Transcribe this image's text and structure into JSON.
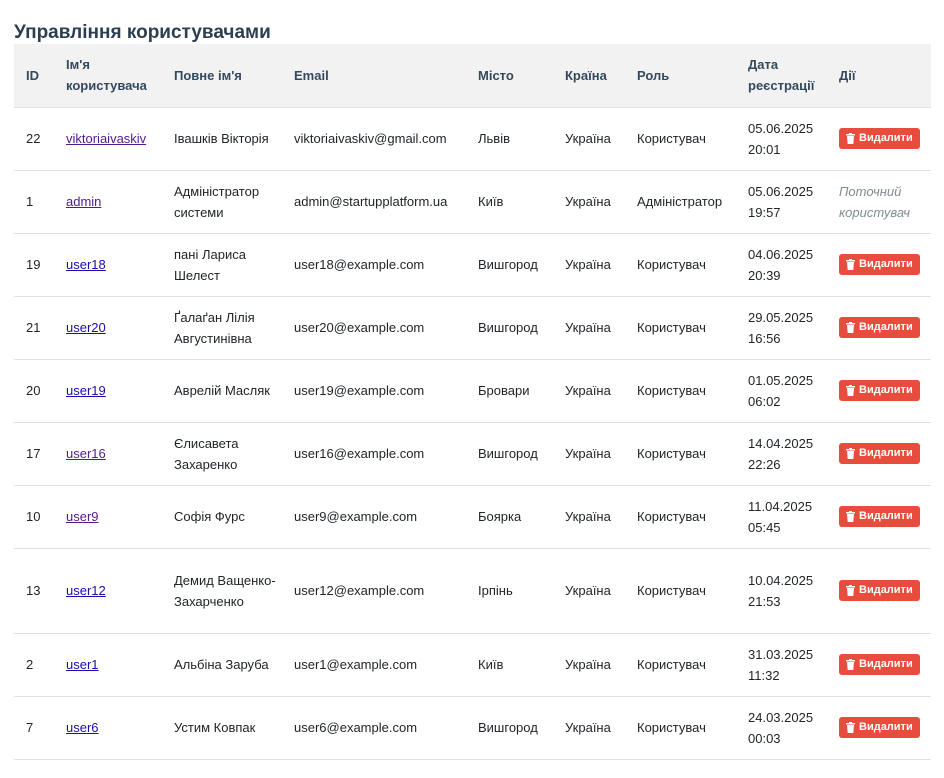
{
  "page": {
    "title": "Управління користувачами"
  },
  "table": {
    "headers": [
      "ID",
      "Ім'я користувача",
      "Повне ім'я",
      "Email",
      "Місто",
      "Країна",
      "Роль",
      "Дата реєстрації",
      "Дії"
    ],
    "delete_label": "Видалити",
    "current_user_label": "Поточний користувач",
    "rows": [
      {
        "id": "22",
        "username": "viktoriaivaskiv",
        "visited": true,
        "full_name": "Івашків Вікторія",
        "email": "viktoriaivaskiv@gmail.com",
        "city": "Львів",
        "country": "Україна",
        "role": "Користувач",
        "date": "05.06.2025",
        "time": "20:01",
        "current": false
      },
      {
        "id": "1",
        "username": "admin",
        "visited": true,
        "full_name": "Адміністратор системи",
        "email": "admin@startupplatform.ua",
        "city": "Київ",
        "country": "Україна",
        "role": "Адміністратор",
        "date": "05.06.2025",
        "time": "19:57",
        "current": true
      },
      {
        "id": "19",
        "username": "user18",
        "visited": false,
        "full_name": "пані Лариса Шелест",
        "email": "user18@example.com",
        "city": "Вишгород",
        "country": "Україна",
        "role": "Користувач",
        "date": "04.06.2025",
        "time": "20:39",
        "current": false
      },
      {
        "id": "21",
        "username": "user20",
        "visited": false,
        "full_name": "Ґалаґан Лілія Августинівна",
        "email": "user20@example.com",
        "city": "Вишгород",
        "country": "Україна",
        "role": "Користувач",
        "date": "29.05.2025",
        "time": "16:56",
        "current": false
      },
      {
        "id": "20",
        "username": "user19",
        "visited": false,
        "full_name": "Аврелій Масляк",
        "email": "user19@example.com",
        "city": "Бровари",
        "country": "Україна",
        "role": "Користувач",
        "date": "01.05.2025",
        "time": "06:02",
        "current": false
      },
      {
        "id": "17",
        "username": "user16",
        "visited": true,
        "full_name": "Єлисавета Захаренко",
        "email": "user16@example.com",
        "city": "Вишгород",
        "country": "Україна",
        "role": "Користувач",
        "date": "14.04.2025",
        "time": "22:26",
        "current": false
      },
      {
        "id": "10",
        "username": "user9",
        "visited": true,
        "full_name": "Софія Фурс",
        "email": "user9@example.com",
        "city": "Боярка",
        "country": "Україна",
        "role": "Користувач",
        "date": "11.04.2025",
        "time": "05:45",
        "current": false
      },
      {
        "id": "13",
        "username": "user12",
        "visited": false,
        "full_name": "Демид Ващенко-Захарченко",
        "email": "user12@example.com",
        "city": "Ірпінь",
        "country": "Україна",
        "role": "Користувач",
        "date": "10.04.2025",
        "time": "21:53",
        "current": false
      },
      {
        "id": "2",
        "username": "user1",
        "visited": false,
        "full_name": "Альбіна Заруба",
        "email": "user1@example.com",
        "city": "Київ",
        "country": "Україна",
        "role": "Користувач",
        "date": "31.03.2025",
        "time": "11:32",
        "current": false
      },
      {
        "id": "7",
        "username": "user6",
        "visited": false,
        "full_name": "Устим Ковпак",
        "email": "user6@example.com",
        "city": "Вишгород",
        "country": "Україна",
        "role": "Користувач",
        "date": "24.03.2025",
        "time": "00:03",
        "current": false
      }
    ]
  },
  "colors": {
    "delete_button": "#e74c3c",
    "header_bg": "#f2f2f2",
    "link": "#1a0dab",
    "link_visited": "#551a8b"
  },
  "icons": {
    "delete": "trash-icon"
  }
}
